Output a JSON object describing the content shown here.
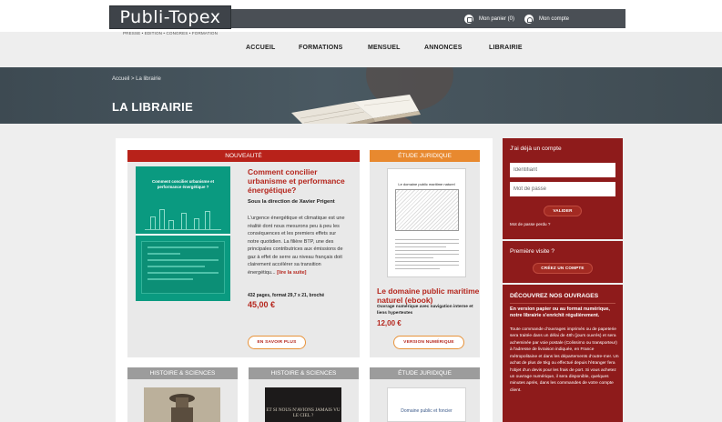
{
  "header": {
    "logo": "Publi-Topex",
    "logo_tagline": "PRESSE • EDITION • CONGRES • FORMATION",
    "cart_label": "Mon panier (0)",
    "account_label": "Mon compte",
    "icons": {
      "cart": "bag-icon",
      "account": "user-icon"
    }
  },
  "nav": {
    "items": [
      {
        "label": "ACCUEIL"
      },
      {
        "label": "FORMATIONS"
      },
      {
        "label": "MENSUEL"
      },
      {
        "label": "ANNONCES"
      },
      {
        "label": "LIBRAIRIE"
      }
    ]
  },
  "hero": {
    "breadcrumb": "Accueil > La librairie",
    "title": "LA LIBRAIRIE"
  },
  "featured": {
    "category": "NOUVEAUTÉ",
    "cover_title": "Comment concilier urbanisme et performance énergétique ?",
    "title": "Comment concilier urbanisme et performance énergétique?",
    "author": "Sous la direction de Xavier Prigent",
    "description": "L'urgence énergétique et climatique est une réalité dont nous mesurons peu à peu les conséquences et les premiers effets sur notre quotidien. La filière BTP, une des principales contributrices aux émissions de gaz à effet de serre au niveau français doit clairement accélérer sa transition énergétiqu...",
    "read_more": "[lire la suite]",
    "format": "432 pages, format 29,7 x 21, broché",
    "price": "45,00 €",
    "button": "EN SAVOIR PLUS"
  },
  "second": {
    "category": "ÉTUDE JURIDIQUE",
    "cover_title": "Le domaine public maritime naturel",
    "title": "Le domaine public maritime naturel (ebook)",
    "subtitle": "Ouvrage numérique avec navigation interne et liens hypertextes",
    "price": "12,00 €",
    "button": "VERSION NUMÉRIQUE"
  },
  "row2": [
    {
      "category": "HISTOIRE & SCIENCES"
    },
    {
      "category": "HISTOIRE & SCIENCES",
      "cover_text": "ET SI NOUS N'AVIONS JAMAIS VU LE CIEL ?"
    },
    {
      "category": "ÉTUDE JURIDIQUE",
      "cover_text": "Domaine public et foncier"
    }
  ],
  "sidebar": {
    "login_title": "J'ai déjà un compte",
    "identifier_placeholder": "Identifiant",
    "password_placeholder": "Mot de passe",
    "submit": "VALIDER",
    "forgot": "Mot de passe perdu ?",
    "first_visit": "Première visite ?",
    "create_account": "CRÉEZ UN COMPTE",
    "discover_title": "DÉCOUVREZ NOS OUVRAGES",
    "discover_lead": "En version papier ou au format numérique, notre librairie s'enrichit régulièrement.",
    "discover_body": "Toute commande d'ouvrages imprimés ou de papeterie sera traitée dans un délai de 48h (jours ouvrés) et sera acheminée par voie postale (Colissimo ou transporteur) à l'adresse de livraison indiquée, en France métropolitaine et dans les départements d'outre-mer. Un achat de plus de 5kg ou effectué depuis l'étranger fera l'objet d'un devis pour les frais de port. Si vous achetez un ouvrage numérique, il sera disponible, quelques minutes après, dans les commandes de votre compte client."
  },
  "colors": {
    "accent_red": "#b5261d",
    "badge_red": "#b8221a",
    "badge_orange": "#e8892f",
    "badge_grey": "#9c9c9c",
    "sidebar_red": "#8e1b1b",
    "hero_slate": "#46535b"
  }
}
